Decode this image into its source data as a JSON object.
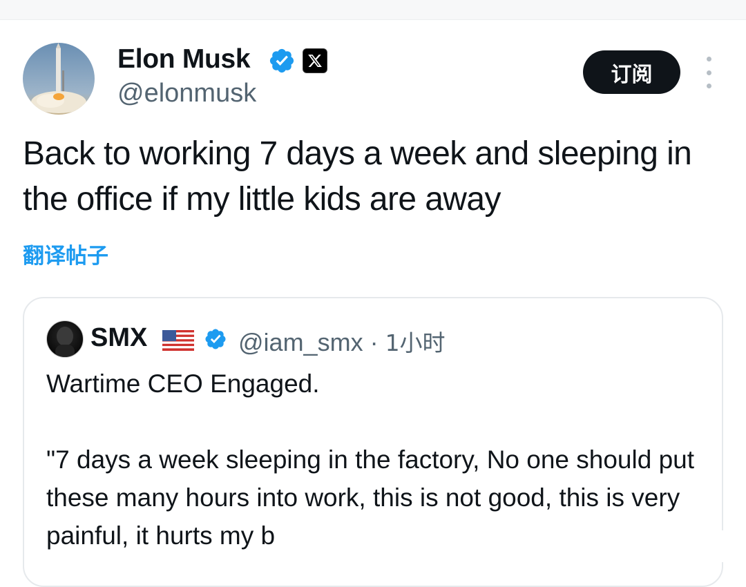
{
  "author": {
    "name": "Elon Musk",
    "handle": "@elonmusk",
    "avatar": "rocket-launch-photo"
  },
  "subscribe_label": "订阅",
  "tweet_text": "Back to working 7 days a week and sleeping in the office if my little kids are away",
  "translate_label": "翻译帖子",
  "quoted": {
    "name": "SMX",
    "flag": "us-flag",
    "handle": "@iam_smx",
    "separator": " · ",
    "time": "1小时",
    "text": "Wartime CEO Engaged.\n\n\"7 days a week sleeping in the factory, No one should put these many hours into work, this is not good, this is very painful, it hurts my b"
  },
  "colors": {
    "link": "#1d9bf0",
    "verified": "#1d9bf0",
    "secondary_text": "#536471",
    "button_bg": "#0f1419"
  }
}
